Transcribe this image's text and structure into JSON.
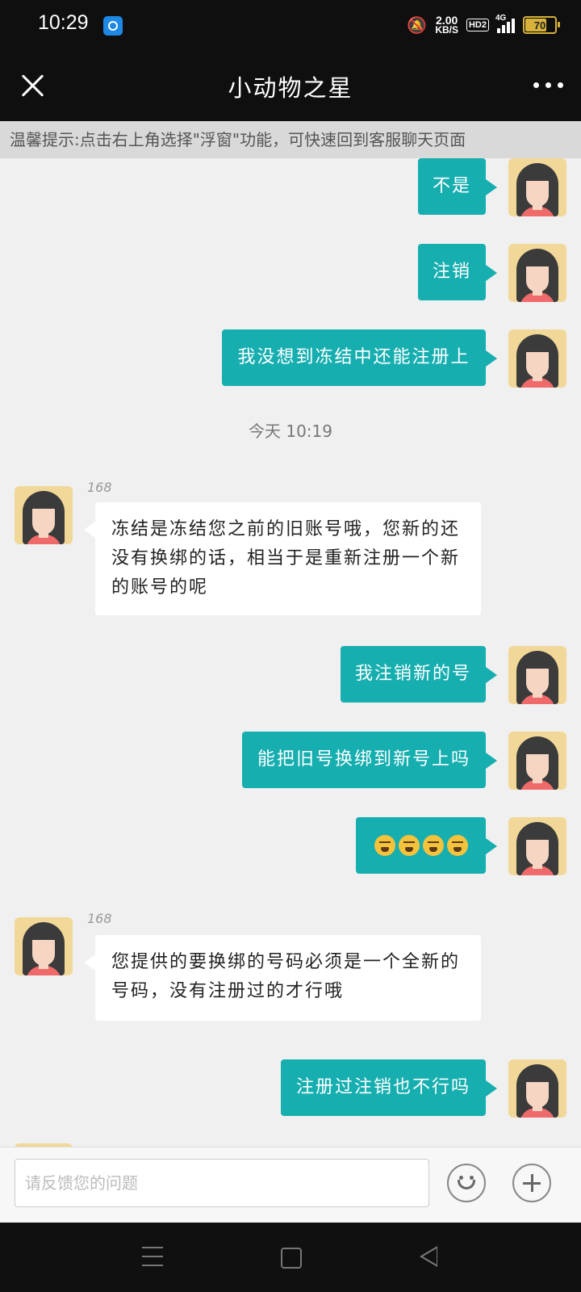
{
  "status_bar": {
    "time": "10:29",
    "net_speed_value": "2.00",
    "net_speed_unit": "KB/S",
    "hd_badge": "HD2",
    "network": "4G",
    "battery": "70"
  },
  "header": {
    "title": "小动物之星"
  },
  "tip_banner": "温馨提示:点击右上角选择\"浮窗\"功能，可快速回到客服聊天页面",
  "messages": {
    "m1": "不是",
    "m2": "注销",
    "m3": "我没想到冻结中还能注册上",
    "time_divider": "今天 10:19",
    "sender1": "168",
    "m4": "冻结是冻结您之前的旧账号哦，您新的还没有换绑的话，相当于是重新注册一个新的账号的呢",
    "m5": "我注销新的号",
    "m6": "能把旧号换绑到新号上吗",
    "m7_emoji": "tired-face x4",
    "sender2": "168",
    "m8": "您提供的要换绑的号码必须是一个全新的号码，没有注册过的才行哦",
    "m9": "注册过注销也不行吗"
  },
  "input": {
    "placeholder": "请反馈您的问题"
  },
  "colors": {
    "my_bubble": "#17aeb0",
    "their_bubble": "#ffffff",
    "chat_bg": "#f0f0f0"
  }
}
